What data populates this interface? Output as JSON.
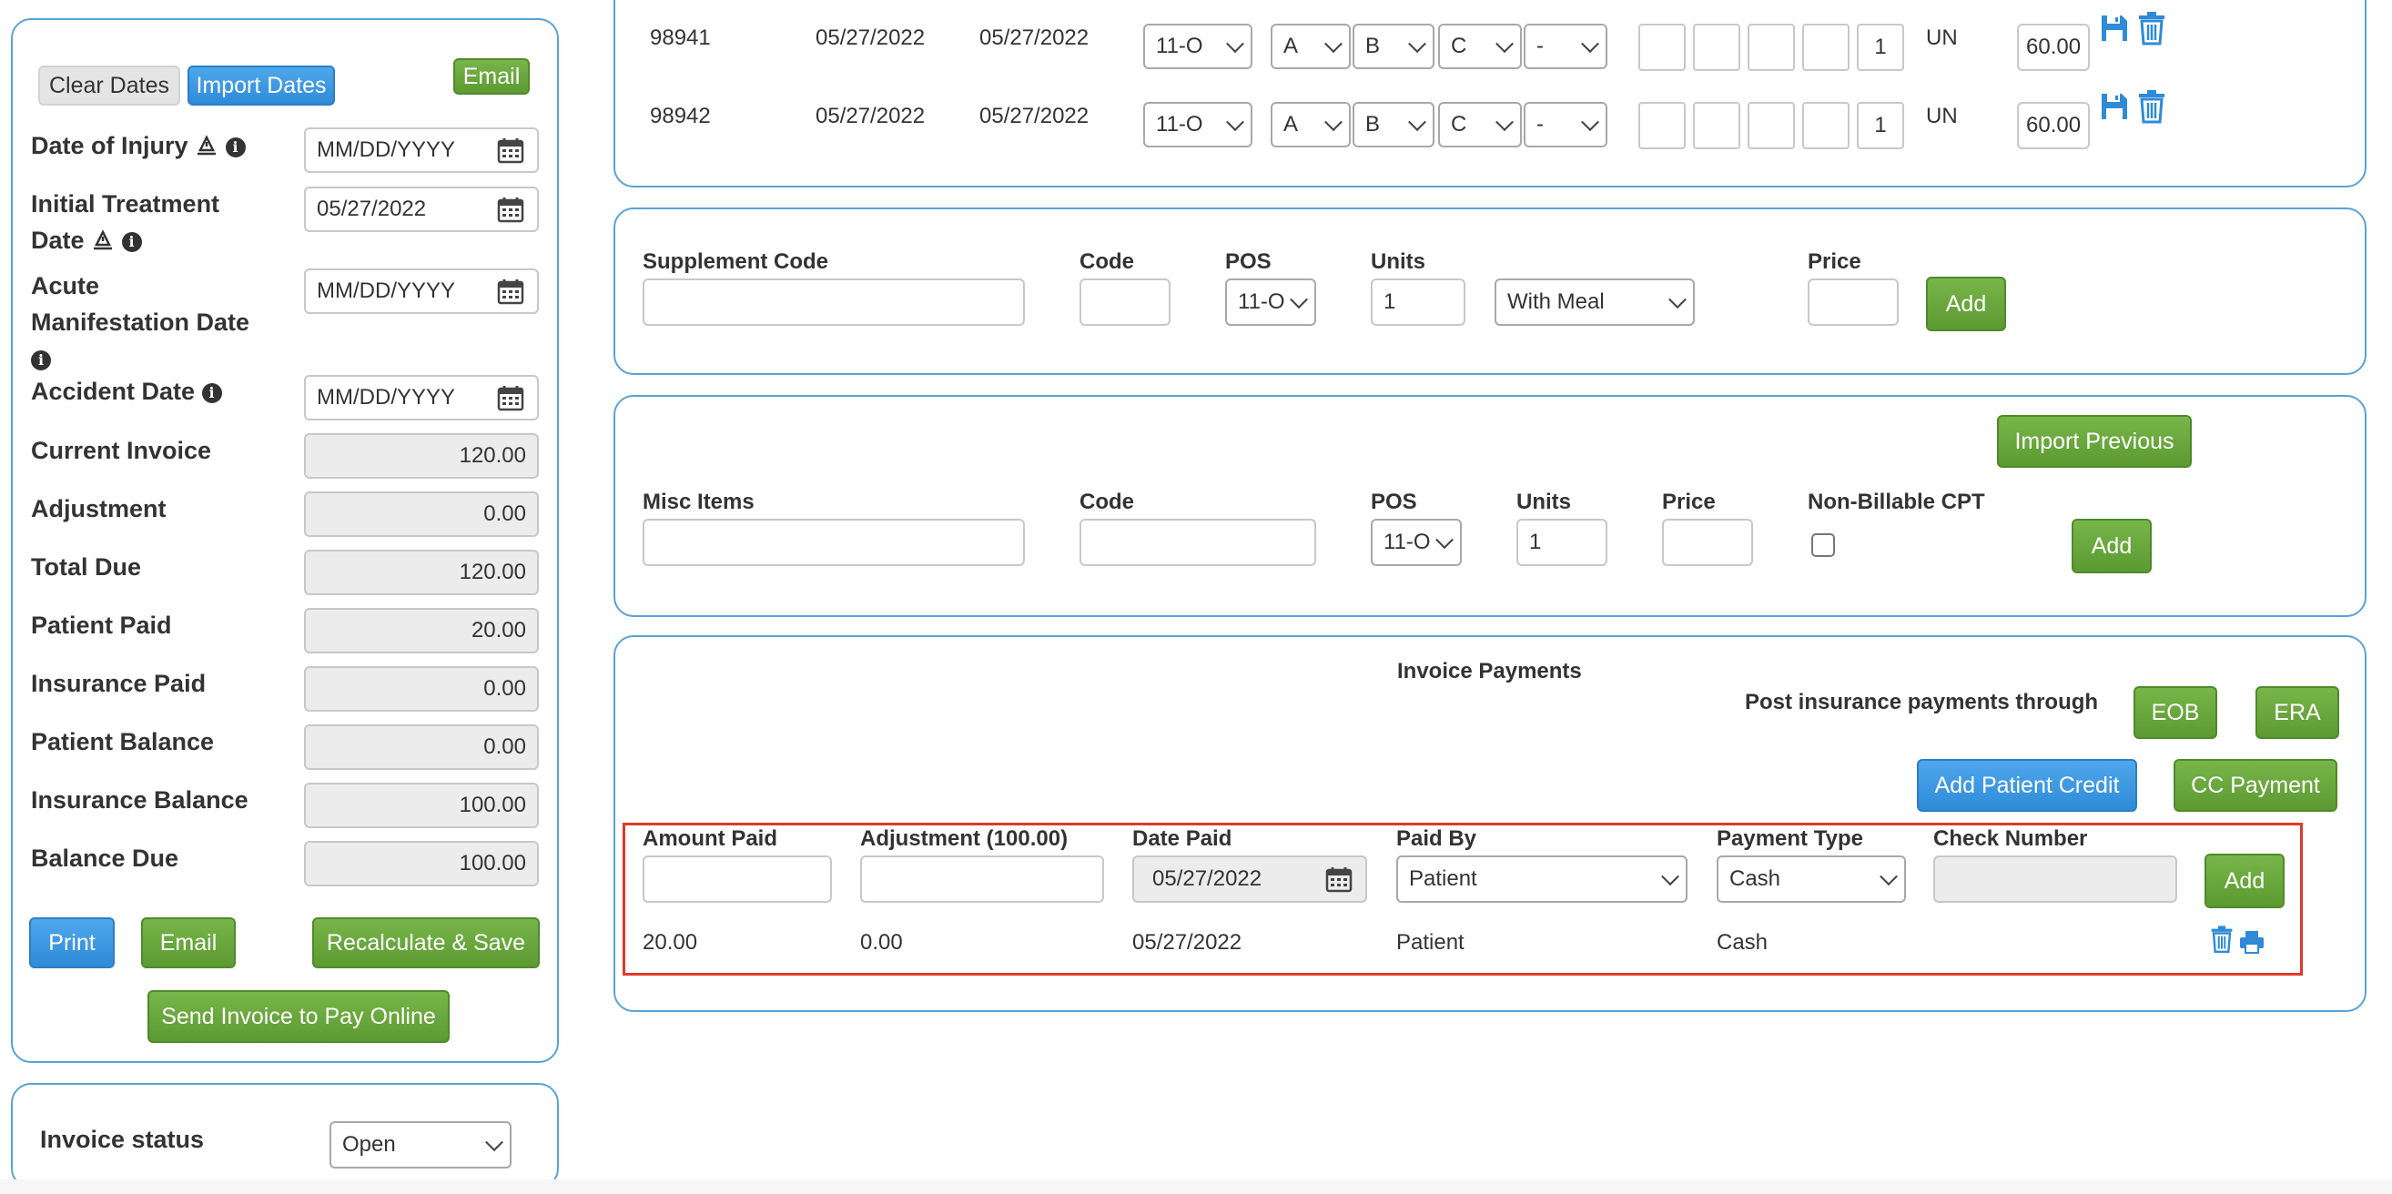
{
  "sidebar": {
    "clear_dates_label": "Clear Dates",
    "import_dates_label": "Import Dates",
    "email_top_label": "Email",
    "fields": [
      {
        "label": "Date of Injury",
        "placeholder": "MM/DD/YYYY",
        "value": ""
      },
      {
        "label_line1": "Initial Treatment",
        "label_line2": "Date",
        "placeholder": "MM/DD/YYYY",
        "value": "05/27/2022"
      },
      {
        "label_line1": "Acute",
        "label_line2": "Manifestation Date",
        "placeholder": "MM/DD/YYYY",
        "value": ""
      },
      {
        "label": "Accident Date",
        "placeholder": "MM/DD/YYYY",
        "value": ""
      }
    ],
    "totals": [
      {
        "label": "Current Invoice",
        "value": "120.00"
      },
      {
        "label": "Adjustment",
        "value": "0.00"
      },
      {
        "label": "Total Due",
        "value": "120.00"
      },
      {
        "label": "Patient Paid",
        "value": "20.00"
      },
      {
        "label": "Insurance Paid",
        "value": "0.00"
      },
      {
        "label": "Patient Balance",
        "value": "0.00"
      },
      {
        "label": "Insurance Balance",
        "value": "100.00"
      },
      {
        "label": "Balance Due",
        "value": "100.00"
      }
    ],
    "print_label": "Print",
    "email_label": "Email",
    "recalc_label": "Recalculate & Save",
    "send_invoice_label": "Send Invoice to Pay Online"
  },
  "status": {
    "label": "Invoice status",
    "value": "Open"
  },
  "line_items": [
    {
      "code": "98941",
      "date1": "05/27/2022",
      "date2": "05/27/2022",
      "pos": "11-O",
      "mod1": "A",
      "mod2": "B",
      "mod3": "C",
      "mod4": "-",
      "units": "1",
      "unit_type": "UN",
      "price": "60.00"
    },
    {
      "code": "98942",
      "date1": "05/27/2022",
      "date2": "05/27/2022",
      "pos": "11-O",
      "mod1": "A",
      "mod2": "B",
      "mod3": "C",
      "mod4": "-",
      "units": "1",
      "unit_type": "UN",
      "price": "60.00"
    }
  ],
  "supplement": {
    "code_header": "Supplement Code",
    "code2_header": "Code",
    "pos_header": "POS",
    "units_header": "Units",
    "price_header": "Price",
    "pos_value": "11-O",
    "units_value": "1",
    "meal_value": "With Meal",
    "add_label": "Add"
  },
  "misc": {
    "import_previous_label": "Import Previous",
    "items_header": "Misc Items",
    "code_header": "Code",
    "pos_header": "POS",
    "units_header": "Units",
    "price_header": "Price",
    "nonbillable_header": "Non-Billable CPT",
    "pos_value": "11-O",
    "units_value": "1",
    "add_label": "Add"
  },
  "payments": {
    "title": "Invoice Payments",
    "post_through_label": "Post insurance payments through",
    "eob_label": "EOB",
    "era_label": "ERA",
    "add_patient_credit_label": "Add Patient Credit",
    "cc_payment_label": "CC Payment",
    "headers": {
      "amount_paid": "Amount Paid",
      "adjustment": "Adjustment (100.00)",
      "date_paid": "Date Paid",
      "paid_by": "Paid By",
      "payment_type": "Payment Type",
      "check_number": "Check Number"
    },
    "form": {
      "date_paid": "05/27/2022",
      "paid_by": "Patient",
      "payment_type": "Cash",
      "add_label": "Add"
    },
    "rows": [
      {
        "amount_paid": "20.00",
        "adjustment": "0.00",
        "date_paid": "05/27/2022",
        "paid_by": "Patient",
        "payment_type": "Cash"
      }
    ],
    "highlight_color": "#e0392b"
  },
  "colors": {
    "panel_border": "#5aa2d6",
    "green_button": "#6aa83e",
    "blue_button": "#3a96e0",
    "icon_blue": "#2f8bd8"
  },
  "icons": [
    "calendar-icon",
    "info-icon",
    "warning-icon",
    "save-icon",
    "trash-icon",
    "print-icon"
  ]
}
